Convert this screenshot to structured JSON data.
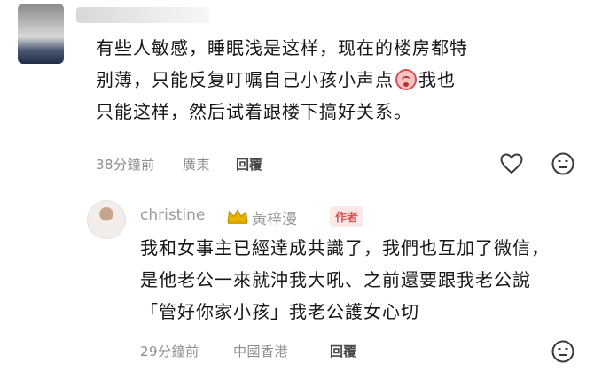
{
  "top_comment": {
    "text_parts": [
      "有些人敏感，睡眠浅是这样，现在的楼房都特别薄，只能反复叮嘱自己小孩小声点",
      "我也只能这样，然后试着跟楼下搞好关系。"
    ],
    "emoji_icon": "distressed-face-icon",
    "time": "38分鐘前",
    "location": "廣東",
    "reply_label": "回覆"
  },
  "reply": {
    "username": "christine",
    "crown_icon": "crown-icon",
    "display_name": "黃梓漫",
    "badge": "作者",
    "text": "我和女事主已經達成共識了，我們也互加了微信，是他老公一來就沖我大吼、之前還要跟我老公說「管好你家小孩」我老公護女心切",
    "time": "29分鐘前",
    "location": "中國香港",
    "reply_label": "回覆"
  },
  "colors": {
    "badge_text": "#d9534f",
    "badge_bg": "#fde8e8",
    "crown": "#d9a400"
  }
}
